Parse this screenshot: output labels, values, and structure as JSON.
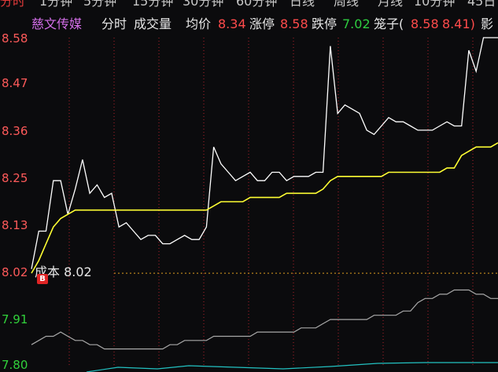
{
  "tabs": [
    "分时",
    "1分钟",
    "5分钟",
    "15分钟",
    "30分钟",
    "60分钟",
    "日线",
    "周线",
    "月线",
    "10分钟",
    "45日"
  ],
  "header": {
    "stock_name": "慈文传媒",
    "mode": "分时",
    "volume_label": "成交量",
    "avg_label": "均价",
    "avg_value": "8.34",
    "limit_up_label": "涨停",
    "limit_up_value": "8.58",
    "limit_down_label": "跌停",
    "limit_down_value": "7.02",
    "cage_label": "笼子(",
    "cage_low": "8.58",
    "cage_high": "8.41)",
    "impact_label": "影"
  },
  "cost": {
    "label": "成本 8.02",
    "badge": "B"
  },
  "colors": {
    "up": "#ff4b4b",
    "down": "#31d13b",
    "price_line": "#ffffff",
    "avg_line": "#ffff33",
    "grid": "#b0202a"
  },
  "chart_data": {
    "type": "line",
    "y_ticks": [
      "8.58",
      "8.47",
      "8.36",
      "8.25",
      "8.13",
      "8.02",
      "7.91",
      "7.80"
    ],
    "ylim": [
      7.8,
      8.58
    ],
    "reference_price": 8.02,
    "series": [
      {
        "values": [
          8.03,
          8.12,
          8.12,
          8.24,
          8.24,
          8.16,
          8.22,
          8.29,
          8.21,
          8.23,
          8.2,
          8.21,
          8.13,
          8.14,
          8.12,
          8.1,
          8.11,
          8.11,
          8.09,
          8.09,
          8.1,
          8.11,
          8.1,
          8.1,
          8.13,
          8.32,
          8.28,
          8.26,
          8.24,
          8.25,
          8.26,
          8.24,
          8.24,
          8.26,
          8.26,
          8.24,
          8.25,
          8.25,
          8.25,
          8.26,
          8.26,
          8.56,
          8.4,
          8.42,
          8.41,
          8.4,
          8.36,
          8.35,
          8.37,
          8.39,
          8.38,
          8.38,
          8.37,
          8.36,
          8.36,
          8.36,
          8.37,
          8.38,
          8.37,
          8.37,
          8.55,
          8.5,
          8.58,
          8.58,
          8.58
        ]
      },
      {
        "values": [
          8.02,
          8.05,
          8.09,
          8.13,
          8.15,
          8.16,
          8.17,
          8.17,
          8.17,
          8.17,
          8.17,
          8.17,
          8.17,
          8.17,
          8.17,
          8.17,
          8.17,
          8.17,
          8.17,
          8.17,
          8.17,
          8.17,
          8.17,
          8.17,
          8.17,
          8.18,
          8.19,
          8.19,
          8.19,
          8.19,
          8.2,
          8.2,
          8.2,
          8.2,
          8.2,
          8.21,
          8.21,
          8.21,
          8.21,
          8.21,
          8.22,
          8.24,
          8.25,
          8.25,
          8.25,
          8.25,
          8.25,
          8.25,
          8.25,
          8.26,
          8.26,
          8.26,
          8.26,
          8.26,
          8.26,
          8.26,
          8.26,
          8.27,
          8.27,
          8.3,
          8.31,
          8.32,
          8.32,
          8.32,
          8.33
        ]
      },
      {
        "values": [
          7.85,
          7.86,
          7.87,
          7.87,
          7.88,
          7.87,
          7.86,
          7.86,
          7.85,
          7.85,
          7.84,
          7.84,
          7.84,
          7.84,
          7.84,
          7.84,
          7.84,
          7.84,
          7.84,
          7.85,
          7.85,
          7.86,
          7.86,
          7.86,
          7.86,
          7.87,
          7.87,
          7.87,
          7.87,
          7.87,
          7.87,
          7.88,
          7.88,
          7.88,
          7.88,
          7.88,
          7.88,
          7.89,
          7.89,
          7.89,
          7.9,
          7.91,
          7.91,
          7.91,
          7.91,
          7.91,
          7.91,
          7.92,
          7.92,
          7.92,
          7.92,
          7.93,
          7.93,
          7.95,
          7.96,
          7.96,
          7.97,
          7.97,
          7.98,
          7.98,
          7.98,
          7.97,
          7.97,
          7.96,
          7.96
        ]
      }
    ]
  }
}
